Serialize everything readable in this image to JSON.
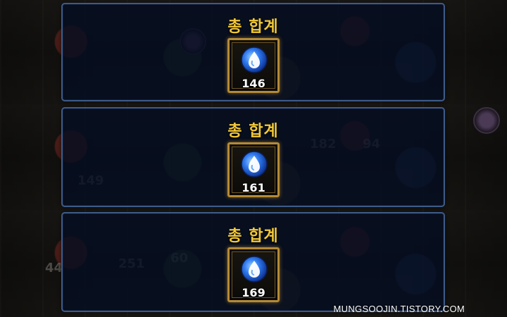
{
  "panels": [
    {
      "title": "총 합계",
      "reward_icon": "water-drop-icon",
      "count": "146"
    },
    {
      "title": "총 합계",
      "reward_icon": "water-drop-icon",
      "count": "161"
    },
    {
      "title": "총 합계",
      "reward_icon": "water-drop-icon",
      "count": "169"
    }
  ],
  "background_numbers": [
    "182",
    "94",
    "149",
    "251",
    "60",
    "44"
  ],
  "watermark": "MUNGSOOJIN.TISTORY.COM",
  "colors": {
    "title": "#f2c838",
    "panel_border": "#3d5a86",
    "slot_border": "#b48a35",
    "drop_blue": "#2f7bf0"
  }
}
